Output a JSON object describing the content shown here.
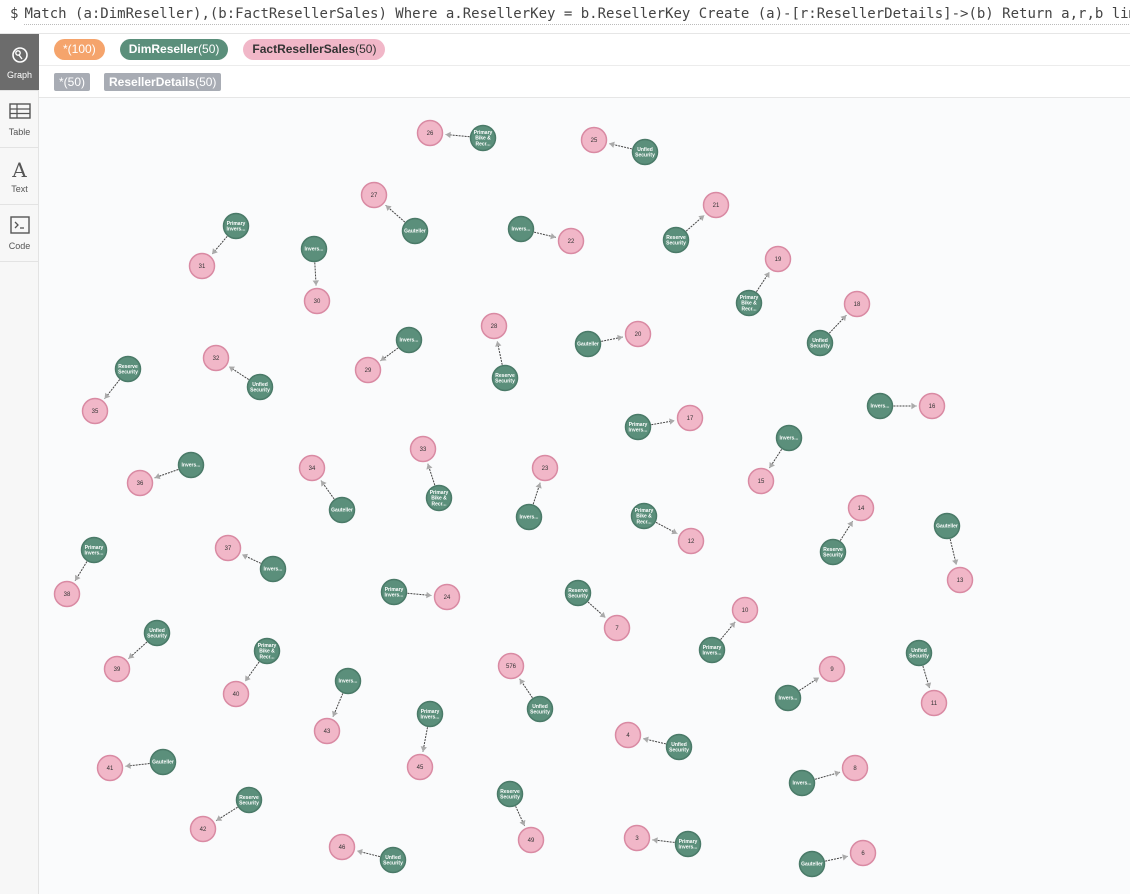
{
  "query": {
    "prompt": "$",
    "text": "Match (a:DimReseller),(b:FactResellerSales) Where a.ResellerKey = b.ResellerKey Create (a)-[r:ResellerDetails]->(b) Return a,r,b limit 50"
  },
  "sidebar": [
    {
      "label": "Graph",
      "icon": "graph-icon",
      "active": true
    },
    {
      "label": "Table",
      "icon": "table-icon",
      "active": false
    },
    {
      "label": "Text",
      "icon": "text-icon",
      "active": false
    },
    {
      "label": "Code",
      "icon": "code-icon",
      "active": false
    }
  ],
  "legend": {
    "nodes": [
      {
        "label": "*",
        "count": "(100)"
      },
      {
        "label": "DimReseller",
        "count": "(50)"
      },
      {
        "label": "FactResellerSales",
        "count": "(50)"
      }
    ],
    "relationships": [
      {
        "label": "*",
        "count": "(50)"
      },
      {
        "label": "ResellerDetails",
        "count": "(50)"
      }
    ]
  },
  "colors": {
    "dim_node": "#5b8f7b",
    "fact_node": "#f1b7c8",
    "fact_stroke": "#d98aa3",
    "edge": "#444444",
    "all_pill": "#f5a46c",
    "rel_tag": "#a8acb4"
  },
  "graph": {
    "pairs": [
      {
        "dim": "Primary Bike & Recr...",
        "fact": "26"
      },
      {
        "dim": "Unfied Security",
        "fact": "25"
      },
      {
        "dim": "Gauteller",
        "fact": "27"
      },
      {
        "dim": "Reserve Security",
        "fact": "21"
      },
      {
        "dim": "Primary Invers...",
        "fact": "31"
      },
      {
        "dim": "Invers...",
        "fact": "30"
      },
      {
        "dim": "Invers...",
        "fact": "22"
      },
      {
        "dim": "Primary Bike & Recr...",
        "fact": "19"
      },
      {
        "dim": "Unfied Security",
        "fact": "18"
      },
      {
        "dim": "Invers...",
        "fact": "29"
      },
      {
        "dim": "Reserve Security",
        "fact": "28"
      },
      {
        "dim": "Gauteller",
        "fact": "20"
      },
      {
        "dim": "Reserve Security",
        "fact": "35"
      },
      {
        "dim": "Unfied Security",
        "fact": "32"
      },
      {
        "dim": "Invers...",
        "fact": "16"
      },
      {
        "dim": "Primary Invers...",
        "fact": "17"
      },
      {
        "dim": "Invers...",
        "fact": "15"
      },
      {
        "dim": "Invers...",
        "fact": "36"
      },
      {
        "dim": "Gauteller",
        "fact": "34"
      },
      {
        "dim": "Primary Bike & Recr...",
        "fact": "33"
      },
      {
        "dim": "Invers...",
        "fact": "23"
      },
      {
        "dim": "Primary Bike & Recr...",
        "fact": "12"
      },
      {
        "dim": "Reserve Security",
        "fact": "14"
      },
      {
        "dim": "Gauteller",
        "fact": "13"
      },
      {
        "dim": "Primary Invers...",
        "fact": "38"
      },
      {
        "dim": "Invers...",
        "fact": "37"
      },
      {
        "dim": "Primary Invers...",
        "fact": "24"
      },
      {
        "dim": "Reserve Security",
        "fact": "7"
      },
      {
        "dim": "Primary Invers...",
        "fact": "10"
      },
      {
        "dim": "Unfied Security",
        "fact": "39"
      },
      {
        "dim": "Primary Bike & Recr...",
        "fact": "40"
      },
      {
        "dim": "Invers...",
        "fact": "43"
      },
      {
        "dim": "Unfied Security",
        "fact": "576"
      },
      {
        "dim": "Invers...",
        "fact": "9"
      },
      {
        "dim": "Unfied Security",
        "fact": "11"
      },
      {
        "dim": "Primary Invers...",
        "fact": "45"
      },
      {
        "dim": "Unfied Security",
        "fact": "4"
      },
      {
        "dim": "Gauteller",
        "fact": "41"
      },
      {
        "dim": "Invers...",
        "fact": "8"
      },
      {
        "dim": "Reserve Security",
        "fact": "42"
      },
      {
        "dim": "Reserve Security",
        "fact": "49"
      },
      {
        "dim": "Primary Invers...",
        "fact": "3"
      },
      {
        "dim": "Unfied Security",
        "fact": "46"
      },
      {
        "dim": "Gauteller",
        "fact": "6"
      }
    ]
  }
}
